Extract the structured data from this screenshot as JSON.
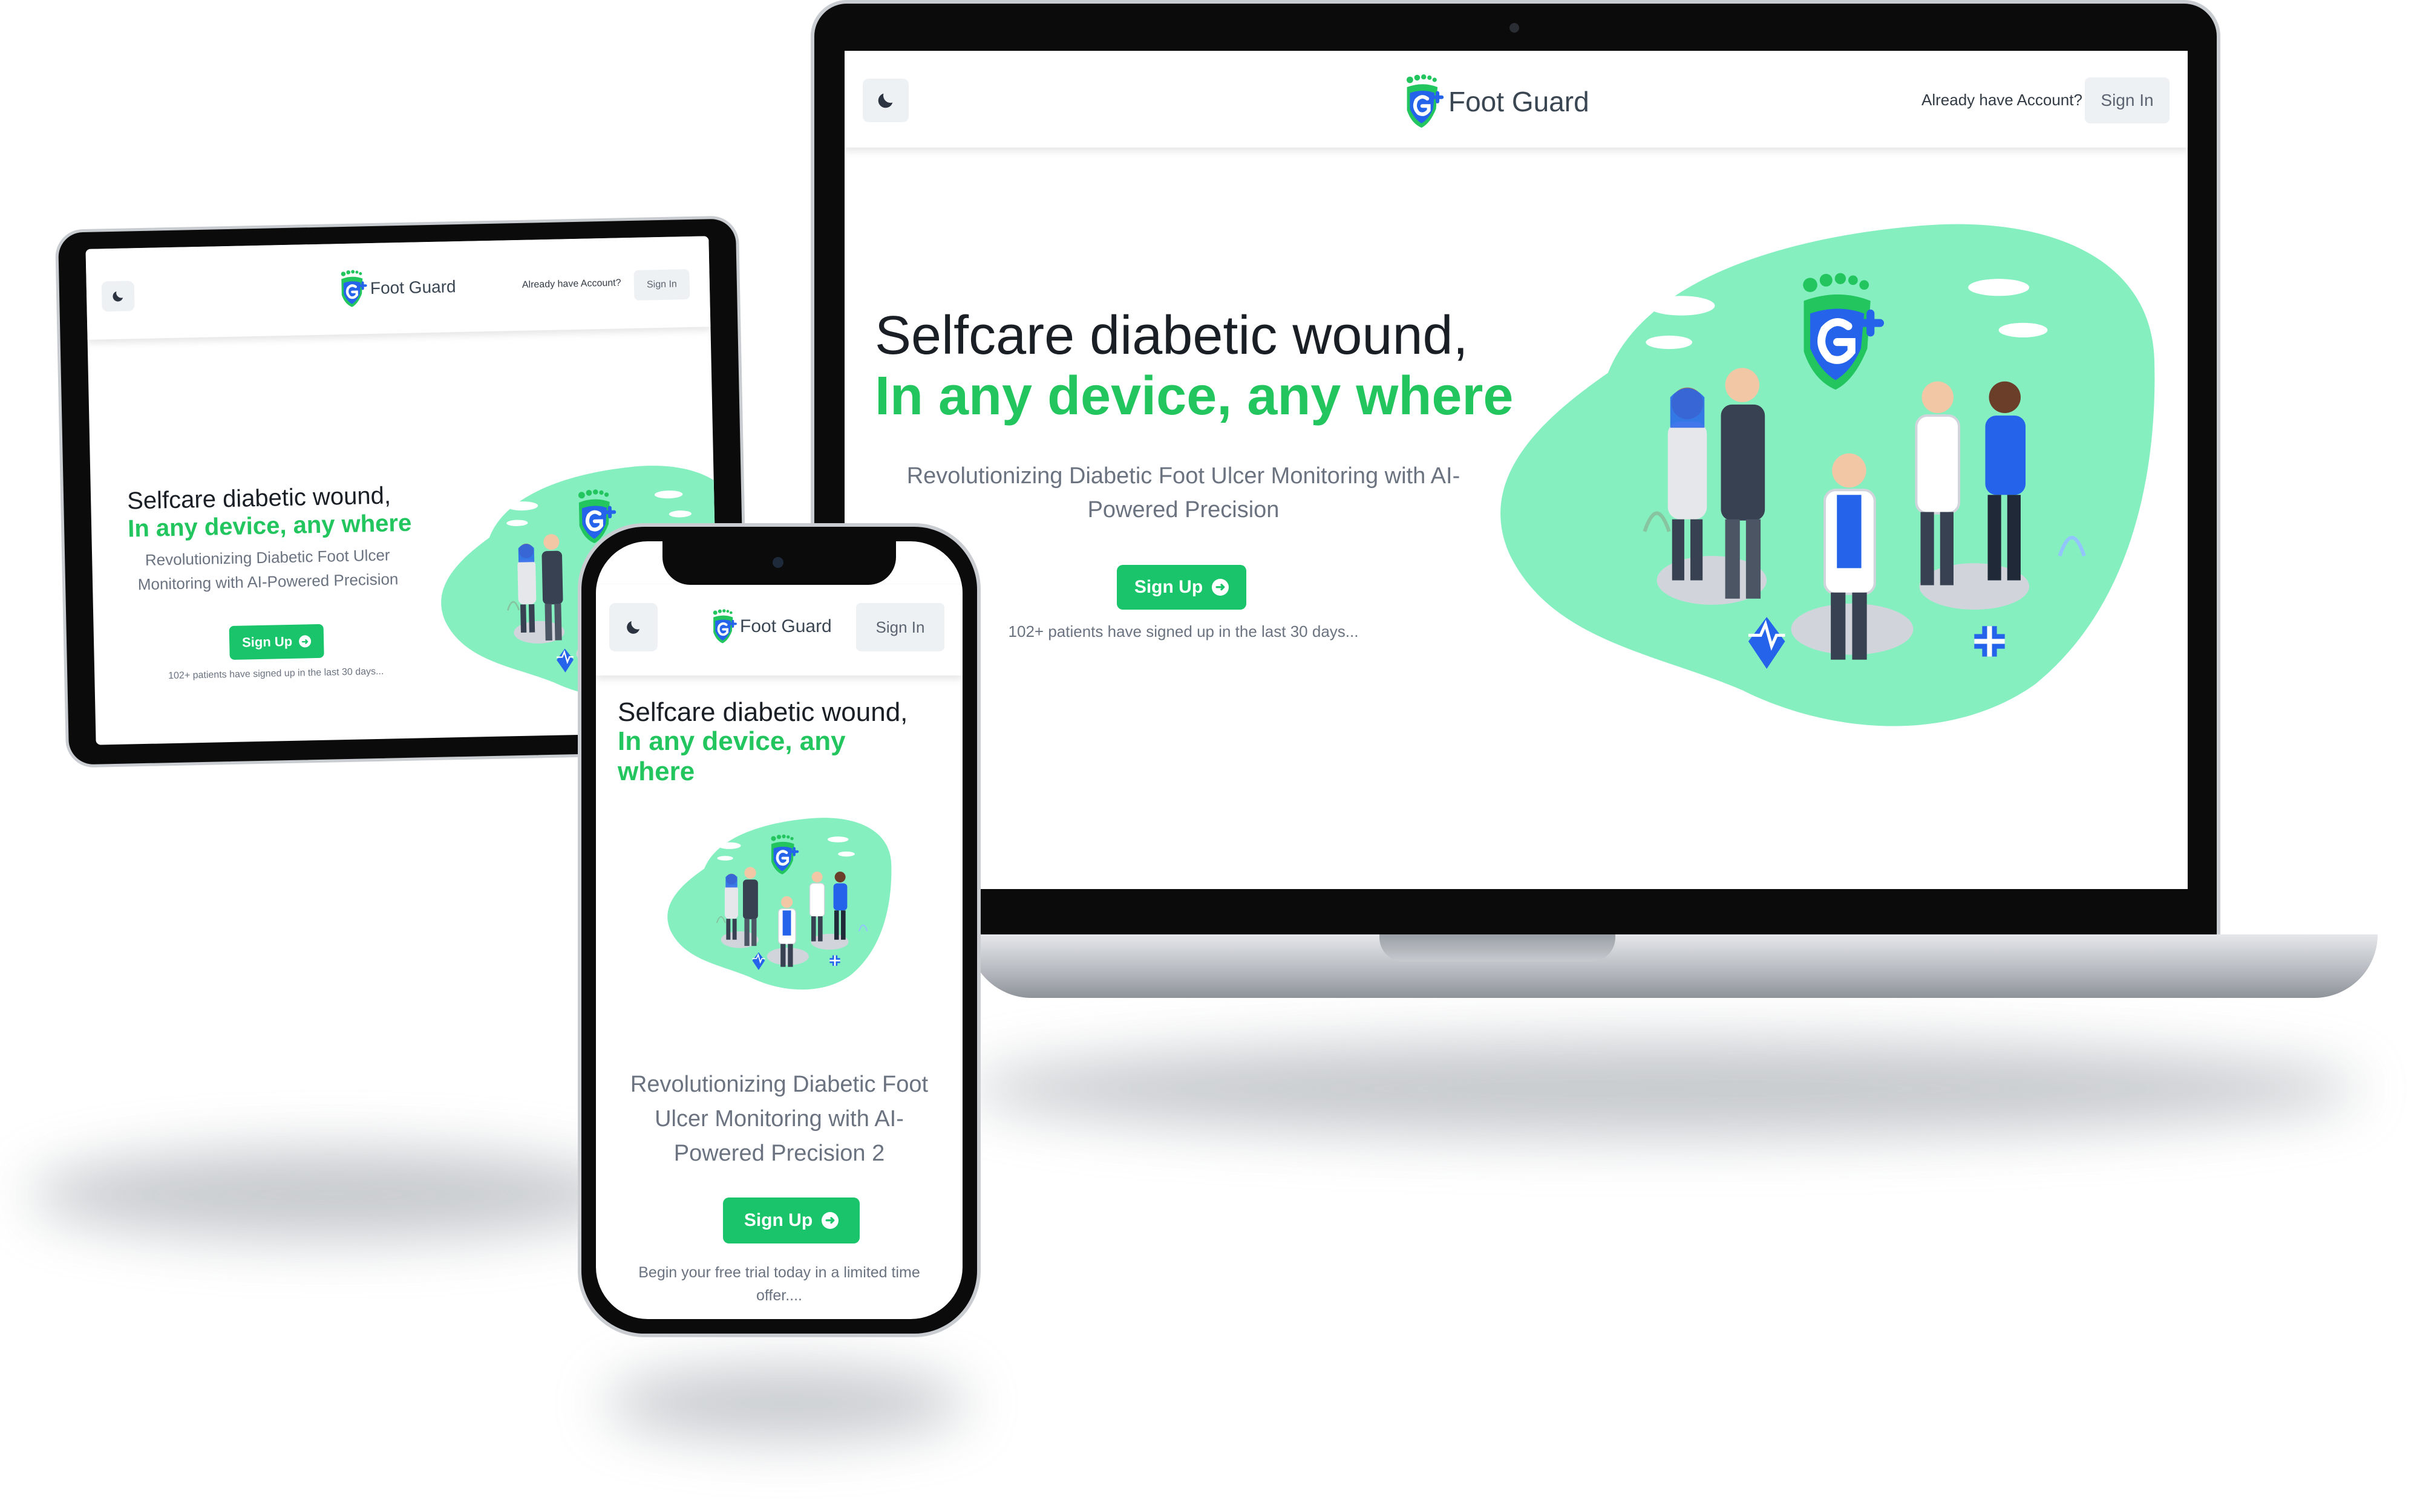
{
  "colors": {
    "accent": "#22c55e",
    "button": "#19c46a",
    "blob": "#86efc0",
    "logo_blue": "#2563eb"
  },
  "laptop": {
    "brand": "Foot Guard",
    "account_question": "Already have Account?",
    "signin": "Sign In",
    "headline_1": "Selfcare diabetic wound,",
    "headline_2": "In any device, any where",
    "subtitle": "Revolutionizing Diabetic Foot Ulcer Monitoring with AI-Powered Precision",
    "signup": "Sign Up",
    "note": "102+ patients have signed up in the last 30 days..."
  },
  "tablet": {
    "brand": "Foot Guard",
    "account_question": "Already have Account?",
    "signin": "Sign In",
    "headline_1": "Selfcare diabetic wound,",
    "headline_2": "In any device, any where",
    "subtitle": "Revolutionizing Diabetic Foot Ulcer Monitoring with AI-Powered Precision",
    "signup": "Sign Up",
    "note": "102+ patients have signed up in the last 30 days..."
  },
  "phone": {
    "brand": "Foot Guard",
    "signin": "Sign In",
    "headline_1": "Selfcare diabetic wound,",
    "headline_2": "In any device, any where",
    "subtitle": "Revolutionizing Diabetic Foot Ulcer Monitoring with AI-Powered Precision 2",
    "signup": "Sign Up",
    "note": "Begin your free trial today in a limited time offer...."
  }
}
